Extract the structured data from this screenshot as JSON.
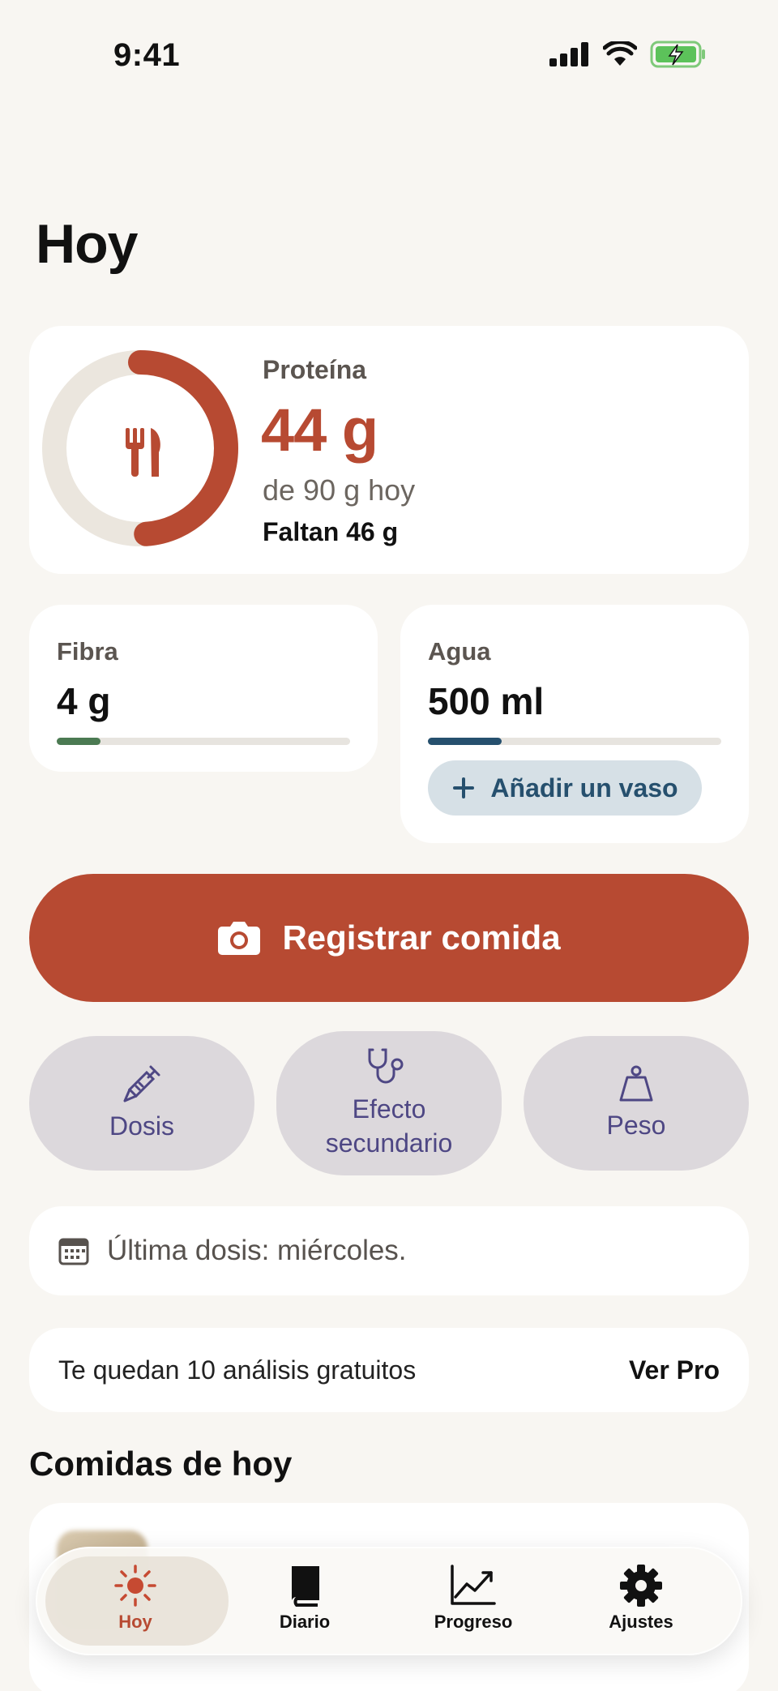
{
  "status_bar": {
    "time": "9:41"
  },
  "header": {
    "title": "Hoy"
  },
  "protein": {
    "label": "Proteína",
    "value": "44 g",
    "subtitle": "de 90 g hoy",
    "remaining": "Faltan 46 g",
    "current_g": 44,
    "goal_g": 90,
    "accent_color": "#b74a32"
  },
  "fiber": {
    "label": "Fibra",
    "value": "4 g",
    "progress": 0.15,
    "color": "#4b7a52"
  },
  "water": {
    "label": "Agua",
    "value": "500 ml",
    "progress": 0.25,
    "color": "#26506e",
    "add_label": "Añadir un vaso"
  },
  "log_meal": {
    "label": "Registrar comida"
  },
  "quick_actions": [
    {
      "icon": "syringe-icon",
      "label": "Dosis"
    },
    {
      "icon": "stethoscope-icon",
      "label_line1": "Efecto",
      "label_line2": "secundario"
    },
    {
      "icon": "scale-weight-icon",
      "label": "Peso"
    }
  ],
  "last_dose": {
    "icon": "calendar-icon",
    "text": "Última dosis: miércoles."
  },
  "free_analyses": {
    "text": "Te quedan 10 análisis gratuitos",
    "link": "Ver Pro"
  },
  "meals_section": {
    "title": "Comidas de hoy"
  },
  "tab_bar": {
    "items": [
      {
        "label": "Hoy",
        "icon": "sun-icon",
        "active": true
      },
      {
        "label": "Diario",
        "icon": "book-icon",
        "active": false
      },
      {
        "label": "Progreso",
        "icon": "chart-line-icon",
        "active": false
      },
      {
        "label": "Ajustes",
        "icon": "gear-icon",
        "active": false
      }
    ]
  }
}
